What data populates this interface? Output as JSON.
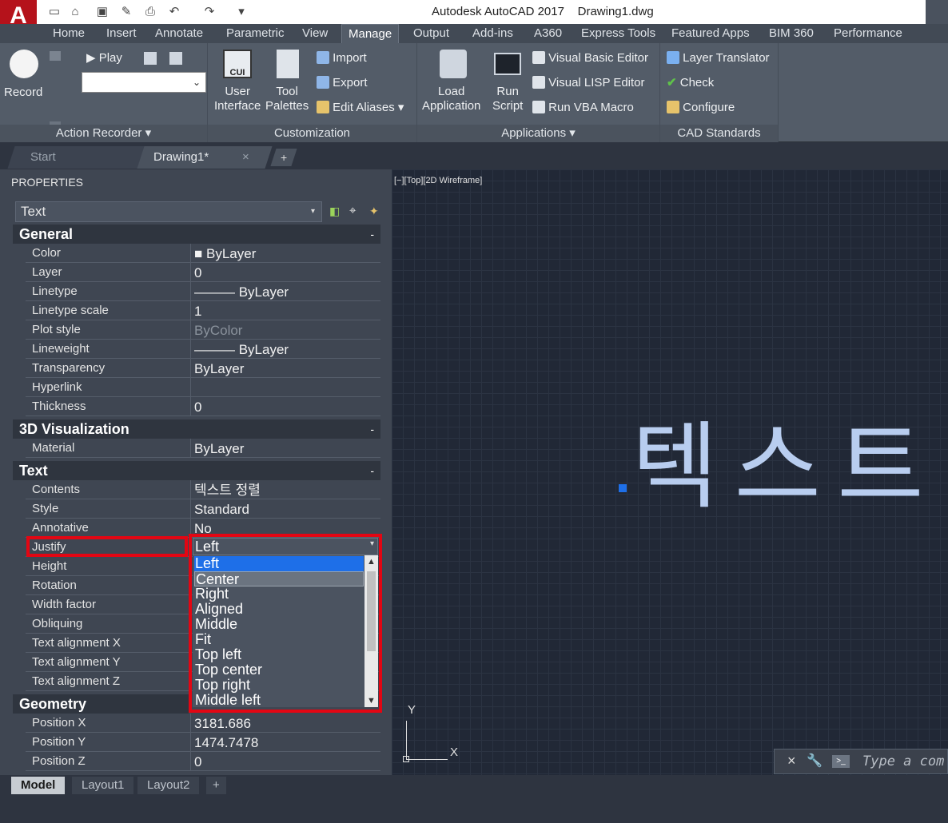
{
  "app": {
    "logo": "A",
    "title": "Autodesk AutoCAD 2017    Drawing1.dwg"
  },
  "ribbon_tabs": [
    "Home",
    "Insert",
    "Annotate",
    "Parametric",
    "View",
    "Manage",
    "Output",
    "Add-ins",
    "A360",
    "Express Tools",
    "Featured Apps",
    "BIM 360",
    "Performance"
  ],
  "active_tab": "Manage",
  "ribbon": {
    "action_recorder": {
      "record": "Record",
      "play": "Play",
      "label": "Action Recorder ▾"
    },
    "customization": {
      "cui_icon": "CUI",
      "user_interface": "User\nInterface",
      "tool_palettes": "Tool\nPalettes",
      "import": "Import",
      "export": "Export",
      "edit_aliases": "Edit Aliases ▾",
      "label": "Customization"
    },
    "applications": {
      "load_app": "Load\nApplication",
      "run_script": "Run\nScript",
      "vba_editor": "Visual Basic Editor",
      "lisp_editor": "Visual LISP Editor",
      "run_vba": "Run VBA Macro",
      "label": "Applications ▾"
    },
    "cad_standards": {
      "layer_translator": "Layer Translator",
      "check": "Check",
      "configure": "Configure",
      "label": "CAD Standards"
    }
  },
  "doc_tabs": {
    "start": "Start",
    "drawing": "Drawing1*",
    "close": "×",
    "add": "+"
  },
  "properties": {
    "title": "PROPERTIES",
    "selected_type": "Text",
    "general": {
      "header": "General",
      "rows": [
        {
          "label": "Color",
          "value": "■ ByLayer"
        },
        {
          "label": "Layer",
          "value": "0"
        },
        {
          "label": "Linetype",
          "value": "——— ByLayer"
        },
        {
          "label": "Linetype scale",
          "value": "1"
        },
        {
          "label": "Plot style",
          "value": "ByColor"
        },
        {
          "label": "Lineweight",
          "value": "——— ByLayer"
        },
        {
          "label": "Transparency",
          "value": "ByLayer"
        },
        {
          "label": "Hyperlink",
          "value": ""
        },
        {
          "label": "Thickness",
          "value": "0"
        }
      ]
    },
    "visualization": {
      "header": "3D Visualization",
      "rows": [
        {
          "label": "Material",
          "value": "ByLayer"
        }
      ]
    },
    "text": {
      "header": "Text",
      "rows": [
        {
          "label": "Contents",
          "value": "텍스트 정렬"
        },
        {
          "label": "Style",
          "value": "Standard"
        },
        {
          "label": "Annotative",
          "value": "No"
        },
        {
          "label": "Justify",
          "value": "Left"
        },
        {
          "label": "Height",
          "value": ""
        },
        {
          "label": "Rotation",
          "value": ""
        },
        {
          "label": "Width factor",
          "value": ""
        },
        {
          "label": "Obliquing",
          "value": ""
        },
        {
          "label": "Text alignment X",
          "value": ""
        },
        {
          "label": "Text alignment Y",
          "value": ""
        },
        {
          "label": "Text alignment Z",
          "value": ""
        }
      ]
    },
    "geometry": {
      "header": "Geometry",
      "rows": [
        {
          "label": "Position X",
          "value": "3181.686"
        },
        {
          "label": "Position Y",
          "value": "1474.7478"
        },
        {
          "label": "Position Z",
          "value": "0"
        }
      ]
    },
    "collapse": "-",
    "justify_options": [
      "Left",
      "Center",
      "Right",
      "Aligned",
      "Middle",
      "Fit",
      "Top left",
      "Top center",
      "Top right",
      "Middle left"
    ],
    "justify_selected": "Left",
    "justify_hover": "Center"
  },
  "viewport": {
    "label": "[−][Top][2D Wireframe]",
    "text_object": "텍스트",
    "ucs_x": "X",
    "ucs_y": "Y",
    "command_placeholder": "Type a com"
  },
  "layout_tabs": [
    "Model",
    "Layout1",
    "Layout2",
    "+"
  ],
  "colors": {
    "accent": "#e30613",
    "selection": "#1e6fe8",
    "text_object": "#b8cdef"
  }
}
